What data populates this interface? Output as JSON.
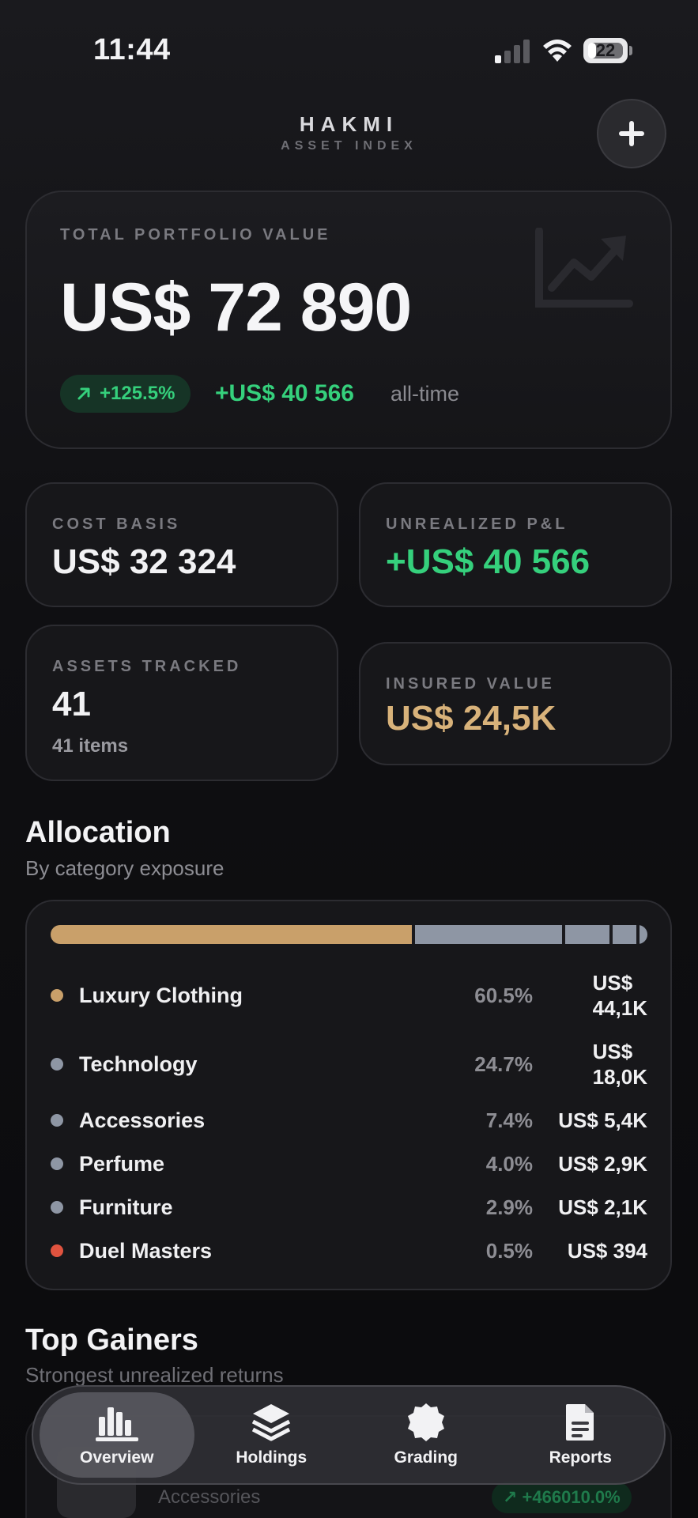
{
  "status_bar": {
    "time": "11:44",
    "battery": "22",
    "battery_level": 0.22
  },
  "header": {
    "brand": "HAKMI",
    "subtitle": "ASSET INDEX",
    "add_icon": "plus-icon"
  },
  "portfolio": {
    "label": "TOTAL PORTFOLIO VALUE",
    "value": "US$ 72 890",
    "change_pct": "+125.5%",
    "change_abs": "+US$ 40 566",
    "period": "all-time",
    "icon": "trend-chart-icon"
  },
  "stats": {
    "cost_basis": {
      "label": "COST BASIS",
      "value": "US$ 32 324"
    },
    "unrealized": {
      "label": "UNREALIZED P&L",
      "value": "+US$ 40 566"
    },
    "assets": {
      "label": "ASSETS TRACKED",
      "value": "41",
      "sub": "41 items"
    },
    "insured": {
      "label": "INSURED VALUE",
      "value": "US$ 24,5K"
    }
  },
  "allocation": {
    "title": "Allocation",
    "subtitle": "By category exposure",
    "rows": [
      {
        "name": "Luxury Clothing",
        "pct": "60.5%",
        "amount_line1": "US$",
        "amount_line2": "44,1K",
        "share": 60.5,
        "color": "#c9a06a"
      },
      {
        "name": "Technology",
        "pct": "24.7%",
        "amount_line1": "US$",
        "amount_line2": "18,0K",
        "share": 24.7,
        "color": "#8e96a4"
      },
      {
        "name": "Accessories",
        "pct": "7.4%",
        "amount": "US$ 5,4K",
        "share": 7.4,
        "color": "#8e96a4"
      },
      {
        "name": "Perfume",
        "pct": "4.0%",
        "amount": "US$ 2,9K",
        "share": 4.0,
        "color": "#8e96a4"
      },
      {
        "name": "Furniture",
        "pct": "2.9%",
        "amount": "US$ 2,1K",
        "share": 2.9,
        "color": "#8e96a4"
      },
      {
        "name": "Duel Masters",
        "pct": "0.5%",
        "amount": "US$ 394",
        "share": 0.5,
        "color": "#e0533f"
      }
    ]
  },
  "top_gainers": {
    "title": "Top Gainers",
    "subtitle": "Strongest unrealized returns",
    "first_item": {
      "category": "Accessories",
      "gain": "↗ +466010.0%"
    }
  },
  "tabs": [
    {
      "label": "Overview",
      "icon": "bar-chart-icon",
      "active": true
    },
    {
      "label": "Holdings",
      "icon": "layers-icon",
      "active": false
    },
    {
      "label": "Grading",
      "icon": "badge-icon",
      "active": false
    },
    {
      "label": "Reports",
      "icon": "document-icon",
      "active": false
    }
  ]
}
